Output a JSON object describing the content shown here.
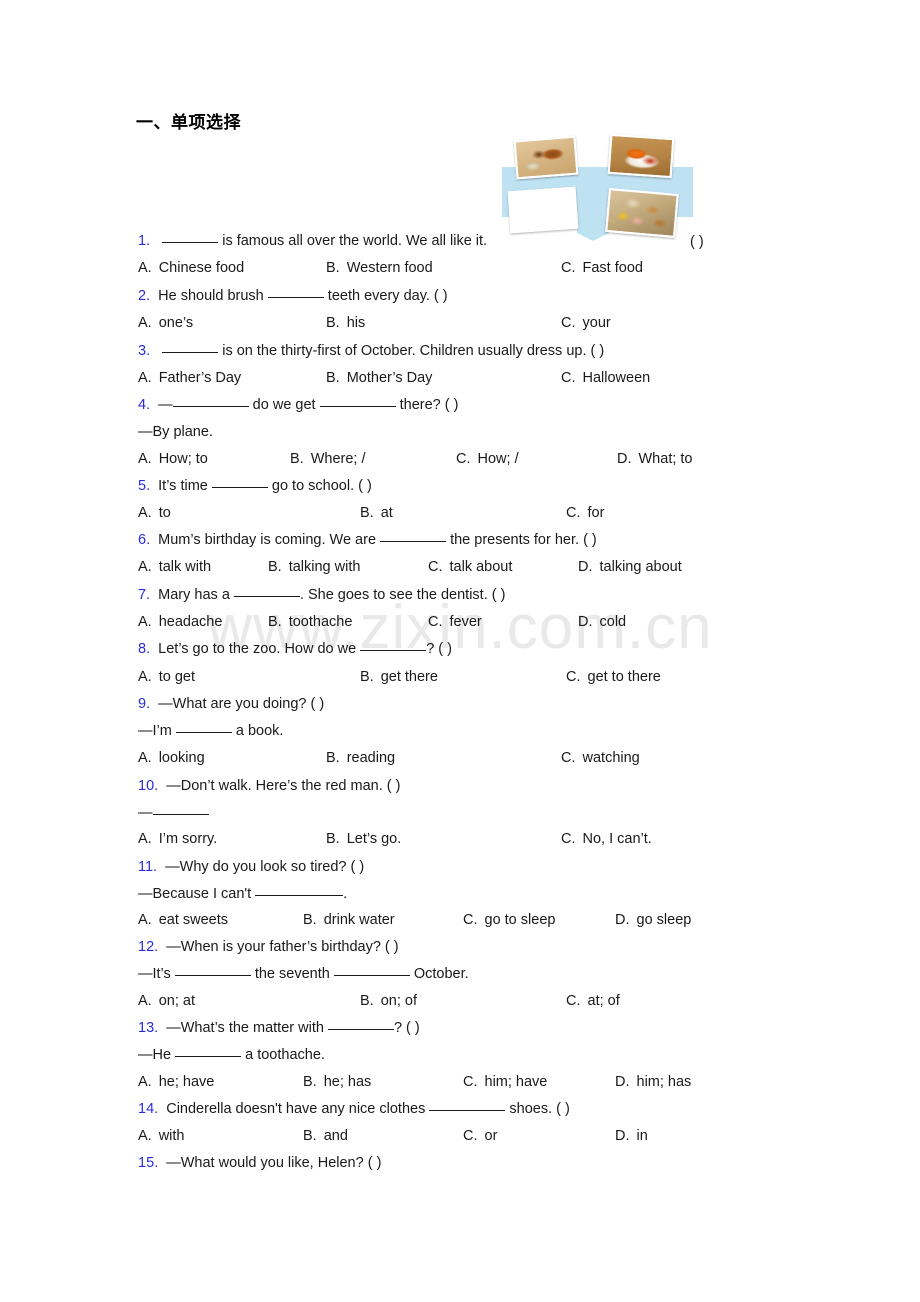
{
  "document": {
    "section_title": "一、单项选择",
    "watermark": "www.zixin.com.cn"
  },
  "illustration": {
    "name": "chinese-food-photo-collage",
    "arrow_color": "#bfe2f2",
    "photos": [
      {
        "name": "roast-duck-photo",
        "alt": "Roast duck dish"
      },
      {
        "name": "chicken-dish-photo",
        "alt": "Spicy chicken dish on white plate"
      },
      {
        "name": "hotpot-photo",
        "alt": "Hot pot with divided broth"
      },
      {
        "name": "dimsum-photo",
        "alt": "Assorted dim sum in bamboo steamers"
      }
    ]
  },
  "questions": [
    {
      "num": "1.",
      "stem_pre": "",
      "blank1": "______",
      "stem_mid": " is famous all over the world. We all like it.",
      "blank2": "",
      "stem_post": "",
      "marker": "(  )",
      "marker_far_right": true,
      "options": [
        {
          "label": "A.",
          "text": "Chinese food"
        },
        {
          "label": "B.",
          "text": "Western food"
        },
        {
          "label": "C.",
          "text": "Fast food"
        }
      ]
    },
    {
      "num": "2.",
      "stem_pre": "He should brush ",
      "blank1": "______",
      "stem_mid": " teeth every day. (   )",
      "options": [
        {
          "label": "A.",
          "text": "one’s"
        },
        {
          "label": "B.",
          "text": "his"
        },
        {
          "label": "C.",
          "text": "your"
        }
      ]
    },
    {
      "num": "3.",
      "stem_pre": "",
      "blank1": "______",
      "stem_mid": " is on the thirty-first of October. Children usually dress up. (   )",
      "options": [
        {
          "label": "A.",
          "text": "Father’s Day"
        },
        {
          "label": "B.",
          "text": "Mother’s Day"
        },
        {
          "label": "C.",
          "text": "Halloween"
        }
      ]
    },
    {
      "num": "4.",
      "stem_pre": "—",
      "blank1": "________",
      "stem_mid": " do we get ",
      "blank2": "________",
      "stem_post": " there? (    )",
      "answer_line": "—By plane.",
      "options": [
        {
          "label": "A.",
          "text": "How; to"
        },
        {
          "label": "B.",
          "text": "Where; /"
        },
        {
          "label": "C.",
          "text": "How; /"
        },
        {
          "label": "D.",
          "text": "What; to"
        }
      ]
    },
    {
      "num": "5.",
      "stem_pre": "It’s time ",
      "blank1": "______",
      "stem_mid": " go to school. (   )",
      "options": [
        {
          "label": "A.",
          "text": "to"
        },
        {
          "label": "B.",
          "text": "at"
        },
        {
          "label": "C.",
          "text": "for"
        }
      ]
    },
    {
      "num": "6.",
      "stem_pre": "Mum’s birthday is coming. We are ",
      "blank1": "_______",
      "stem_mid": " the presents for her. (  )",
      "options": [
        {
          "label": "A.",
          "text": "talk with"
        },
        {
          "label": "B.",
          "text": "talking with"
        },
        {
          "label": "C.",
          "text": "talk about"
        },
        {
          "label": "D.",
          "text": "talking about"
        }
      ]
    },
    {
      "num": "7.",
      "stem_pre": "Mary has a ",
      "blank1": "_______",
      "stem_mid": ". She goes to see the dentist. (  )",
      "options": [
        {
          "label": "A.",
          "text": "headache"
        },
        {
          "label": "B.",
          "text": "toothache"
        },
        {
          "label": "C.",
          "text": "fever"
        },
        {
          "label": "D.",
          "text": "cold"
        }
      ]
    },
    {
      "num": "8.",
      "stem_pre": "Let’s go to the zoo. How do we ",
      "blank1": "_______",
      "stem_mid": "? (   )",
      "options": [
        {
          "label": "A.",
          "text": "to get"
        },
        {
          "label": "B.",
          "text": "get there"
        },
        {
          "label": "C.",
          "text": "get to there"
        }
      ]
    },
    {
      "num": "9.",
      "stem_pre": "—What are you doing? (",
      "stem_mid": "     )",
      "answer_line_pre": "—I’m ",
      "answer_blank": "_______",
      "answer_line_post": " a book.",
      "options": [
        {
          "label": "A.",
          "text": "looking"
        },
        {
          "label": "B.",
          "text": "reading"
        },
        {
          "label": "C.",
          "text": "watching"
        }
      ]
    },
    {
      "num": "10.",
      "stem_pre": "—Don’t walk. Here’s the red man. (  )",
      "answer_line_pre": "—",
      "answer_blank": "______",
      "answer_line_post": "",
      "options": [
        {
          "label": "A.",
          "text": "I’m sorry."
        },
        {
          "label": "B.",
          "text": "Let’s go."
        },
        {
          "label": "C.",
          "text": "No, I can’t."
        }
      ]
    },
    {
      "num": "11.",
      "stem_pre": "—Why do you look so tired? (  )",
      "answer_line_pre": "—Because I can't ",
      "answer_blank": "___________",
      "answer_line_post": ".",
      "options": [
        {
          "label": "A.",
          "text": "eat sweets"
        },
        {
          "label": "B.",
          "text": "drink water"
        },
        {
          "label": "C.",
          "text": "go to sleep"
        },
        {
          "label": "D.",
          "text": "go sleep"
        }
      ]
    },
    {
      "num": "12.",
      "stem_pre": "—When is your father’s birthday? (   )",
      "answer_line_pre": "—It’s ",
      "answer_blank": "________",
      "answer_line_mid": " the seventh ",
      "answer_blank2": "________",
      "answer_line_post": " October.",
      "options": [
        {
          "label": "A.",
          "text": "on; at"
        },
        {
          "label": "B.",
          "text": "on; of"
        },
        {
          "label": "C.",
          "text": "at; of"
        }
      ]
    },
    {
      "num": "13.",
      "stem_pre": "—What’s the matter with ",
      "blank1": "_______",
      "stem_mid": "? (  )",
      "answer_line_pre": "—He ",
      "answer_blank": "________",
      "answer_line_post": " a toothache.",
      "options": [
        {
          "label": "A.",
          "text": "he; have"
        },
        {
          "label": "B.",
          "text": "he; has"
        },
        {
          "label": "C.",
          "text": "him; have"
        },
        {
          "label": "D.",
          "text": "him; has"
        }
      ]
    },
    {
      "num": "14.",
      "stem_pre": "Cinderella doesn't have any nice clothes ",
      "blank1": "________",
      "stem_mid": " shoes. (  )",
      "options": [
        {
          "label": "A.",
          "text": "with"
        },
        {
          "label": "B.",
          "text": "and"
        },
        {
          "label": "C.",
          "text": "or"
        },
        {
          "label": "D.",
          "text": "in"
        }
      ]
    },
    {
      "num": "15.",
      "stem_pre": "—What would you like, Helen? (   )",
      "options": []
    }
  ]
}
